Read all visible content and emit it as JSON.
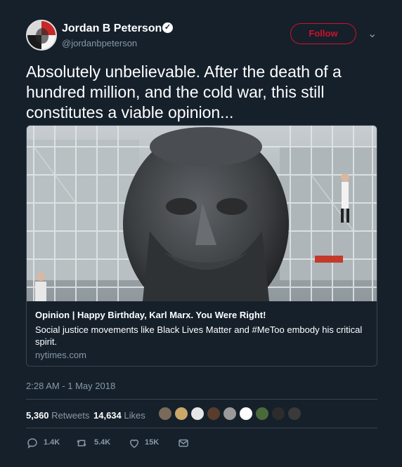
{
  "author": {
    "name": "Jordan B Peterson",
    "handle": "@jordanbpeterson",
    "verified_icon": "verified-badge-icon"
  },
  "header": {
    "follow_label": "Follow",
    "menu_icon": "chevron-down-icon"
  },
  "tweet": {
    "text": "Absolutely unbelievable. After the death of a hundred million, and the cold war, this still constitutes a viable opinion...",
    "timestamp": "2:28 AM - 1 May 2018"
  },
  "card": {
    "title": "Opinion | Happy Birthday, Karl Marx. You Were Right!",
    "description": "Social justice movements like Black Lives Matter and #MeToo embody his critical spirit.",
    "domain": "nytimes.com",
    "image_icon": "karl-marx-monument-photo"
  },
  "stats": {
    "retweets_count": "5,360",
    "retweets_label": "Retweets",
    "likes_count": "14,634",
    "likes_label": "Likes",
    "liker_colors": [
      "#7a6a5a",
      "#c9a86a",
      "#e6e6e6",
      "#5a3c2c",
      "#9a9a9a",
      "#ffffff",
      "#4a6a3a",
      "#2c2c2c",
      "#3a3a3a"
    ]
  },
  "actions": {
    "reply_count": "1.4K",
    "retweet_count": "5.4K",
    "like_count": "15K"
  },
  "colors": {
    "background": "#15202b",
    "follow_accent": "#d0112b",
    "muted": "#8899a6",
    "border": "#38444d"
  }
}
